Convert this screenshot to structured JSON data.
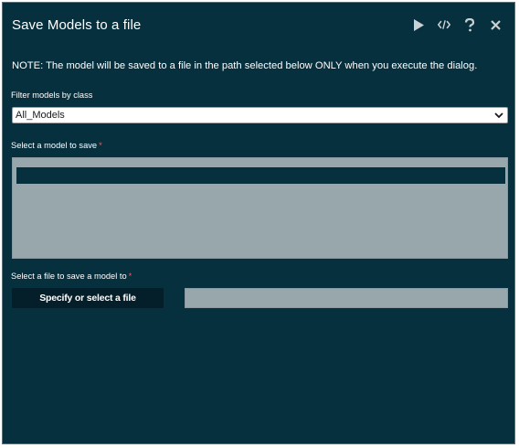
{
  "dialog": {
    "title": "Save Models to a file",
    "toolbar": {
      "run_icon": "play-icon",
      "code_icon": "code-icon",
      "help_icon": "question-icon",
      "close_icon": "close-icon"
    },
    "note": "NOTE: The model will be saved to a file in the path selected below ONLY when you execute the dialog."
  },
  "filter": {
    "label": "Filter models by class",
    "selected": "All_Models"
  },
  "model_select": {
    "label": "Select a model to save",
    "required_mark": "*",
    "items": [
      ""
    ]
  },
  "file_select": {
    "label": "Select a file to save a model to",
    "required_mark": "*",
    "button_label": "Specify or select a file",
    "value": ""
  },
  "colors": {
    "background": "#07303f",
    "listbox": "#98a7ac",
    "button": "#041e2a",
    "required": "#e06060"
  }
}
